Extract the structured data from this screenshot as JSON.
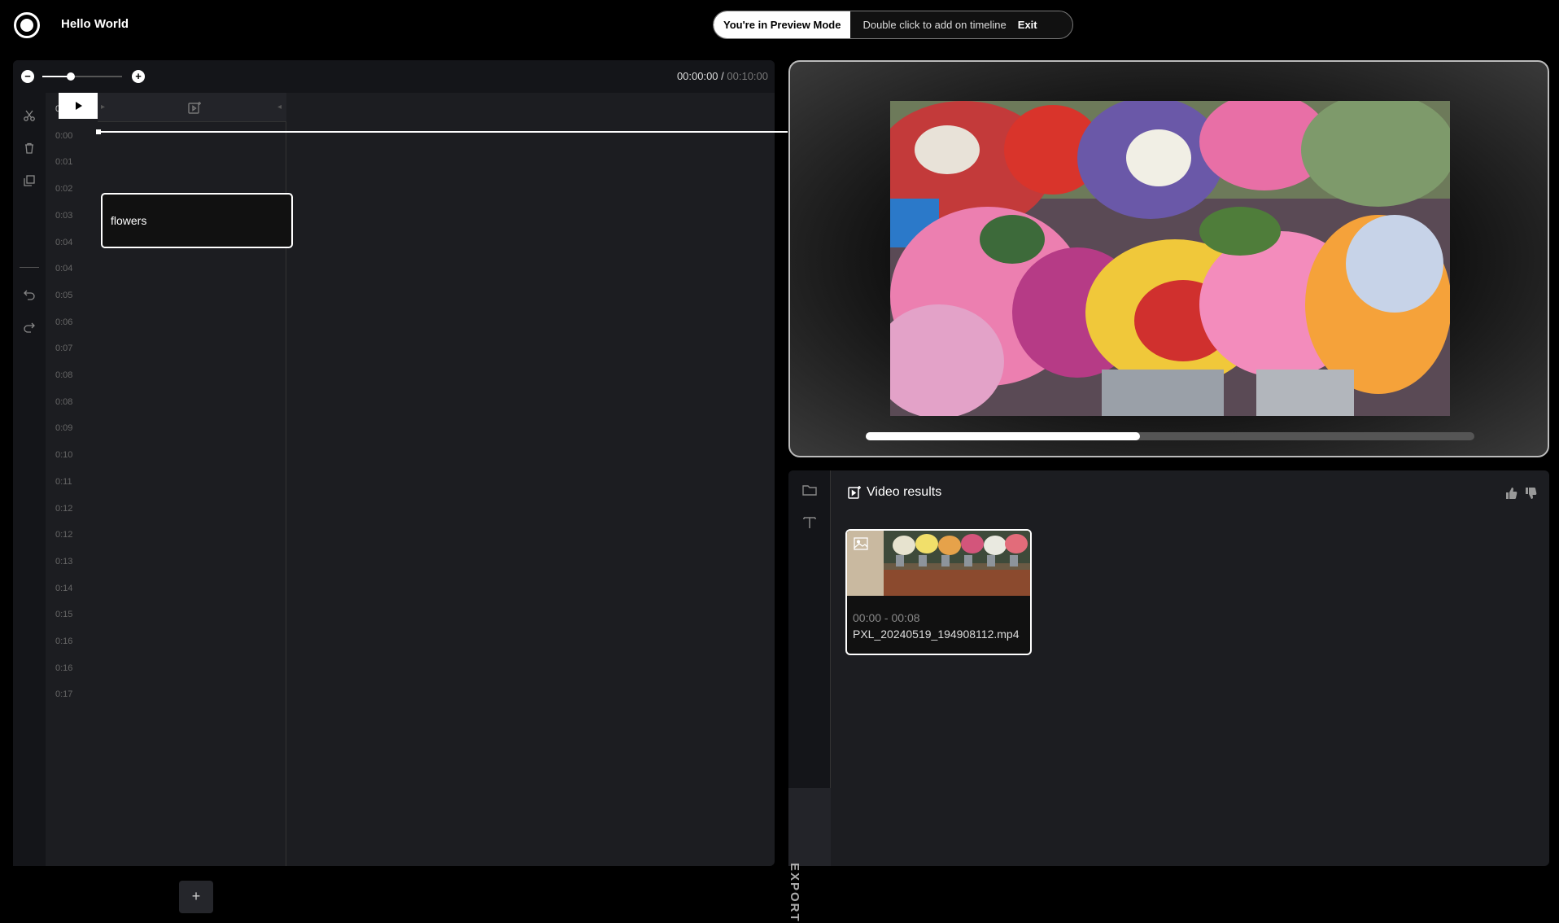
{
  "header": {
    "app_title": "Hello World",
    "preview_mode_label": "You're in Preview Mode",
    "preview_hint": "Double click to add on timeline",
    "exit_label": "Exit"
  },
  "timeline": {
    "zoom_minus": "−",
    "zoom_plus": "+",
    "zoom_level_fraction": 0.36,
    "current_time": "00:00:00",
    "separator": " / ",
    "total_time": "00:10:00",
    "ruler_ticks": [
      "0:00",
      "0:00",
      "0:01",
      "0:02",
      "0:03",
      "0:04",
      "0:04",
      "0:05",
      "0:06",
      "0:07",
      "0:08",
      "0:08",
      "0:09",
      "0:10",
      "0:11",
      "0:12",
      "0:12",
      "0:13",
      "0:14",
      "0:15",
      "0:16",
      "0:16",
      "0:17"
    ],
    "clip_label": "flowers",
    "add_track_label": "+",
    "tools": [
      "scissors-icon",
      "trash-icon",
      "duplicate-icon",
      "undo-icon",
      "redo-icon"
    ]
  },
  "player": {
    "progress_fraction": 0.45
  },
  "results": {
    "title": "Video results",
    "export_label": "EXPORT",
    "side_icons": [
      "folder-icon",
      "text-icon"
    ],
    "items": [
      {
        "range": "00:00 - 00:08",
        "filename": "PXL_20240519_194908112.mp4"
      }
    ]
  },
  "colors": {
    "background": "#000000",
    "panel": "#1c1d21",
    "accent": "#ffffff"
  }
}
